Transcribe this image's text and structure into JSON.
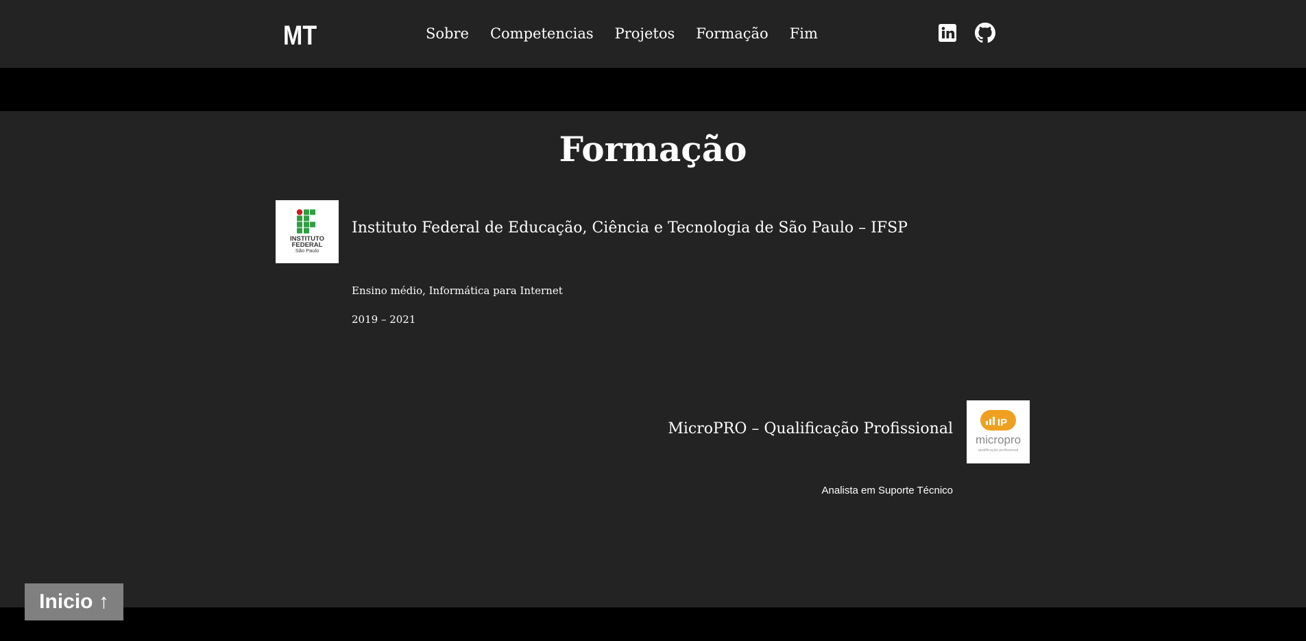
{
  "navbar": {
    "logo": "MT",
    "links": [
      {
        "label": "Sobre"
      },
      {
        "label": "Competencias"
      },
      {
        "label": "Projetos"
      },
      {
        "label": "Formação"
      },
      {
        "label": "Fim"
      }
    ],
    "social": [
      {
        "icon": "linkedin-icon"
      },
      {
        "icon": "github-icon"
      }
    ]
  },
  "section": {
    "title": "Formação"
  },
  "education": [
    {
      "logo_text_line1": "INSTITUTO",
      "logo_text_line2": "FEDERAL",
      "logo_text_line3": "São Paulo",
      "title": "Instituto Federal de Educação, Ciência e Tecnologia de São Paulo – IFSP",
      "course": "Ensino médio, Informática para Internet",
      "years": "2019 – 2021"
    },
    {
      "logo_text_line1": "micropro",
      "logo_text_line2": "qualificação profissional",
      "title": "MicroPRO – Qualificação Profissional",
      "role": "Analista em Suporte Técnico"
    }
  ],
  "top_button": {
    "label": "Inicio ↑"
  },
  "colors": {
    "background": "#232323",
    "band": "#000000",
    "text": "#ffffff",
    "button": "#808080",
    "ifsp_green": "#2f9e41",
    "ifsp_red": "#cd191e",
    "micropro_orange": "#f0a020"
  }
}
